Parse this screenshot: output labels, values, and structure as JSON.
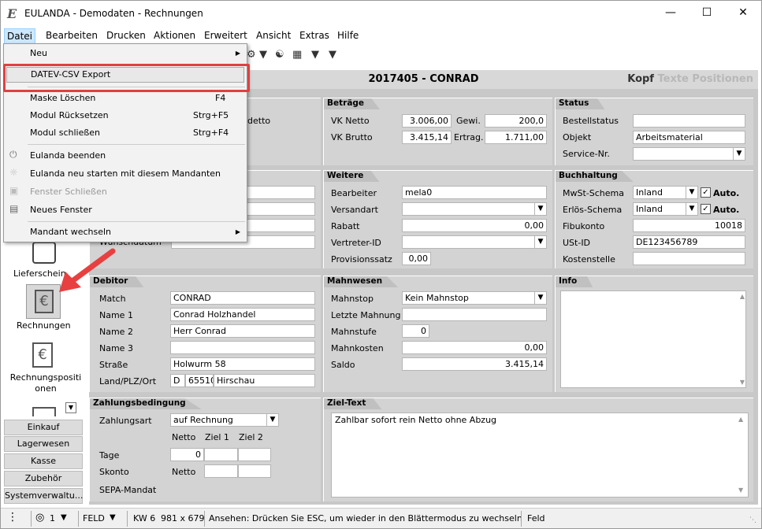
{
  "window": {
    "title": "EULANDA - Demodaten - Rechnungen",
    "logo": "E"
  },
  "menubar": [
    "Datei",
    "Bearbeiten",
    "Drucken",
    "Aktionen",
    "Erweitert",
    "Ansicht",
    "Extras",
    "Hilfe"
  ],
  "datei_menu": [
    {
      "label": "Neu",
      "shortcut": "",
      "arrow": "▶"
    },
    {
      "label": "DATEV-CSV Export",
      "shortcut": ""
    },
    {
      "label": "Maske Löschen",
      "shortcut": "F4"
    },
    {
      "label": "Modul Rücksetzen",
      "shortcut": "Strg+F5"
    },
    {
      "label": "Modul schließen",
      "shortcut": "Strg+F4"
    },
    {
      "label": "Eulanda beenden",
      "shortcut": ""
    },
    {
      "label": "Eulanda neu starten mit  diesem Mandanten",
      "shortcut": ""
    },
    {
      "label": "Fenster Schließen",
      "shortcut": ""
    },
    {
      "label": "Neues Fenster",
      "shortcut": ""
    },
    {
      "label": "Mandant wechseln",
      "shortcut": "",
      "arrow": "▶"
    }
  ],
  "header": {
    "doc_title": "2017405 - CONRAD",
    "tab_kopf": "Kopf",
    "tab_texte": "Texte",
    "tab_positionen": "Positionen"
  },
  "betraege": {
    "title": "Beträge",
    "vk_netto_label": "VK Netto",
    "vk_netto": "3.006,00",
    "gewi_label": "Gewi.",
    "gewi": "200,0",
    "vk_brutto_label": "VK Brutto",
    "vk_brutto": "3.415,14",
    "ertrag_label": "Ertrag.",
    "ertrag": "1.711,00"
  },
  "status": {
    "title": "Status",
    "bestellstatus_label": "Bestellstatus",
    "objekt_label": "Objekt",
    "objekt": "Arbeitsmaterial",
    "service_label": "Service-Nr."
  },
  "weitere": {
    "title": "Weitere",
    "bearbeiter_label": "Bearbeiter",
    "bearbeiter": "mela0",
    "versandart_label": "Versandart",
    "rabatt_label": "Rabatt",
    "rabatt": "0,00",
    "vertreter_label": "Vertreter-ID",
    "provision_label": "Provisionssatz",
    "provision": "0,00"
  },
  "buchhaltung": {
    "title": "Buchhaltung",
    "mwst_label": "MwSt-Schema",
    "mwst": "Inland",
    "erloes_label": "Erlös-Schema",
    "erloes": "Inland",
    "auto": "Auto.",
    "fibukonto_label": "Fibukonto",
    "fibukonto": "10018",
    "ustid_label": "USt-ID",
    "ustid": "DE123456789",
    "kostenstelle_label": "Kostenstelle"
  },
  "left_partial": {
    "frag1": "detto",
    "frag2": "Wunschdatum"
  },
  "debitor": {
    "title": "Debitor",
    "match_label": "Match",
    "match": "CONRAD",
    "name1_label": "Name 1",
    "name1": "Conrad Holzhandel",
    "name2_label": "Name 2",
    "name2": "Herr Conrad",
    "name3_label": "Name 3",
    "strasse_label": "Straße",
    "strasse": "Holwurm 58",
    "plz_label": "Land/PLZ/Ort",
    "land": "D",
    "plz": "65510",
    "ort": "Hirschau"
  },
  "mahnwesen": {
    "title": "Mahnwesen",
    "mahnstop_label": "Mahnstop",
    "mahnstop": "Kein Mahnstop",
    "letzte_label": "Letzte Mahnung",
    "stufe_label": "Mahnstufe",
    "stufe": "0",
    "kosten_label": "Mahnkosten",
    "kosten": "0,00",
    "saldo_label": "Saldo",
    "saldo": "3.415,14"
  },
  "info": {
    "title": "Info"
  },
  "zahlung": {
    "title": "Zahlungsbedingung",
    "art_label": "Zahlungsart",
    "art": "auf Rechnung",
    "netto_h": "Netto",
    "ziel1_h": "Ziel 1",
    "ziel2_h": "Ziel 2",
    "tage_label": "Tage",
    "tage": "0",
    "skonto_label": "Skonto",
    "skonto": "Netto",
    "sepa_label": "SEPA-Mandat"
  },
  "ziel": {
    "title": "Ziel-Text",
    "text": "Zahlbar sofort rein Netto ohne Abzug"
  },
  "sidebar": {
    "lieferschein": "Lieferschein",
    "rechnungen": "Rechnungen",
    "rechnungspositionen": "Rechnungspositi onen",
    "buttons": [
      "Einkauf",
      "Lagerwesen",
      "Kasse",
      "Zubehör",
      "Systemverwaltu..."
    ]
  },
  "statusbar": {
    "count": "1",
    "mode": "FELD",
    "kw": "KW 6",
    "size": "981 x 679",
    "msg": "Ansehen: Drücken Sie ESC, um wieder in den Blättermodus zu wechseln",
    "right": "Feld"
  },
  "colors": {
    "highlight_box": "#e04040",
    "arrow": "#e84040",
    "menu_hover": "#cce8ff"
  }
}
